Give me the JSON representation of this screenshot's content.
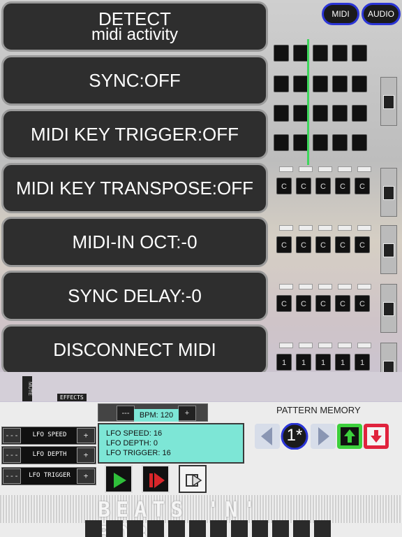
{
  "header": {
    "midi_label": "MIDI",
    "audio_label": "AUDIO"
  },
  "menu": {
    "detect_title": "DETECT",
    "detect_sub": "midi activity",
    "sync": "SYNC:OFF",
    "key_trigger": "MIDI KEY TRIGGER:OFF",
    "key_transpose": "MIDI KEY TRANSPOSE:OFF",
    "midi_in_oct": "MIDI-IN OCT:-0",
    "sync_delay": "SYNC DELAY:-0",
    "disconnect": "DISCONNECT MIDI"
  },
  "sequencer": {
    "note_label": "C",
    "row_value": "1",
    "mute_label": "MUTE",
    "effects_label": "EFFECTS"
  },
  "bpm": {
    "label": "BPM: 120",
    "minus": "---",
    "plus": "+"
  },
  "lfo": {
    "speed_btn": "LFO SPEED",
    "depth_btn": "LFO DEPTH",
    "trigger_btn": "LFO TRIGGER",
    "minus": "---",
    "plus": "+",
    "panel_speed": "LFO SPEED: 16",
    "panel_depth": "LFO DEPTH: 0",
    "panel_trigger": "LFO TRIGGER: 16"
  },
  "pattern_memory": {
    "title": "PATTERN MEMORY",
    "slot": "1*"
  },
  "logo": {
    "text": "BEATS 'N' BOBS"
  },
  "colors": {
    "accent_blue": "#2b35d6",
    "teal_panel": "#7de6d6",
    "play_green": "#2fbf3a",
    "record_red": "#d8262a",
    "pm_green": "#3ccf3c",
    "pm_red": "#e0233d"
  }
}
